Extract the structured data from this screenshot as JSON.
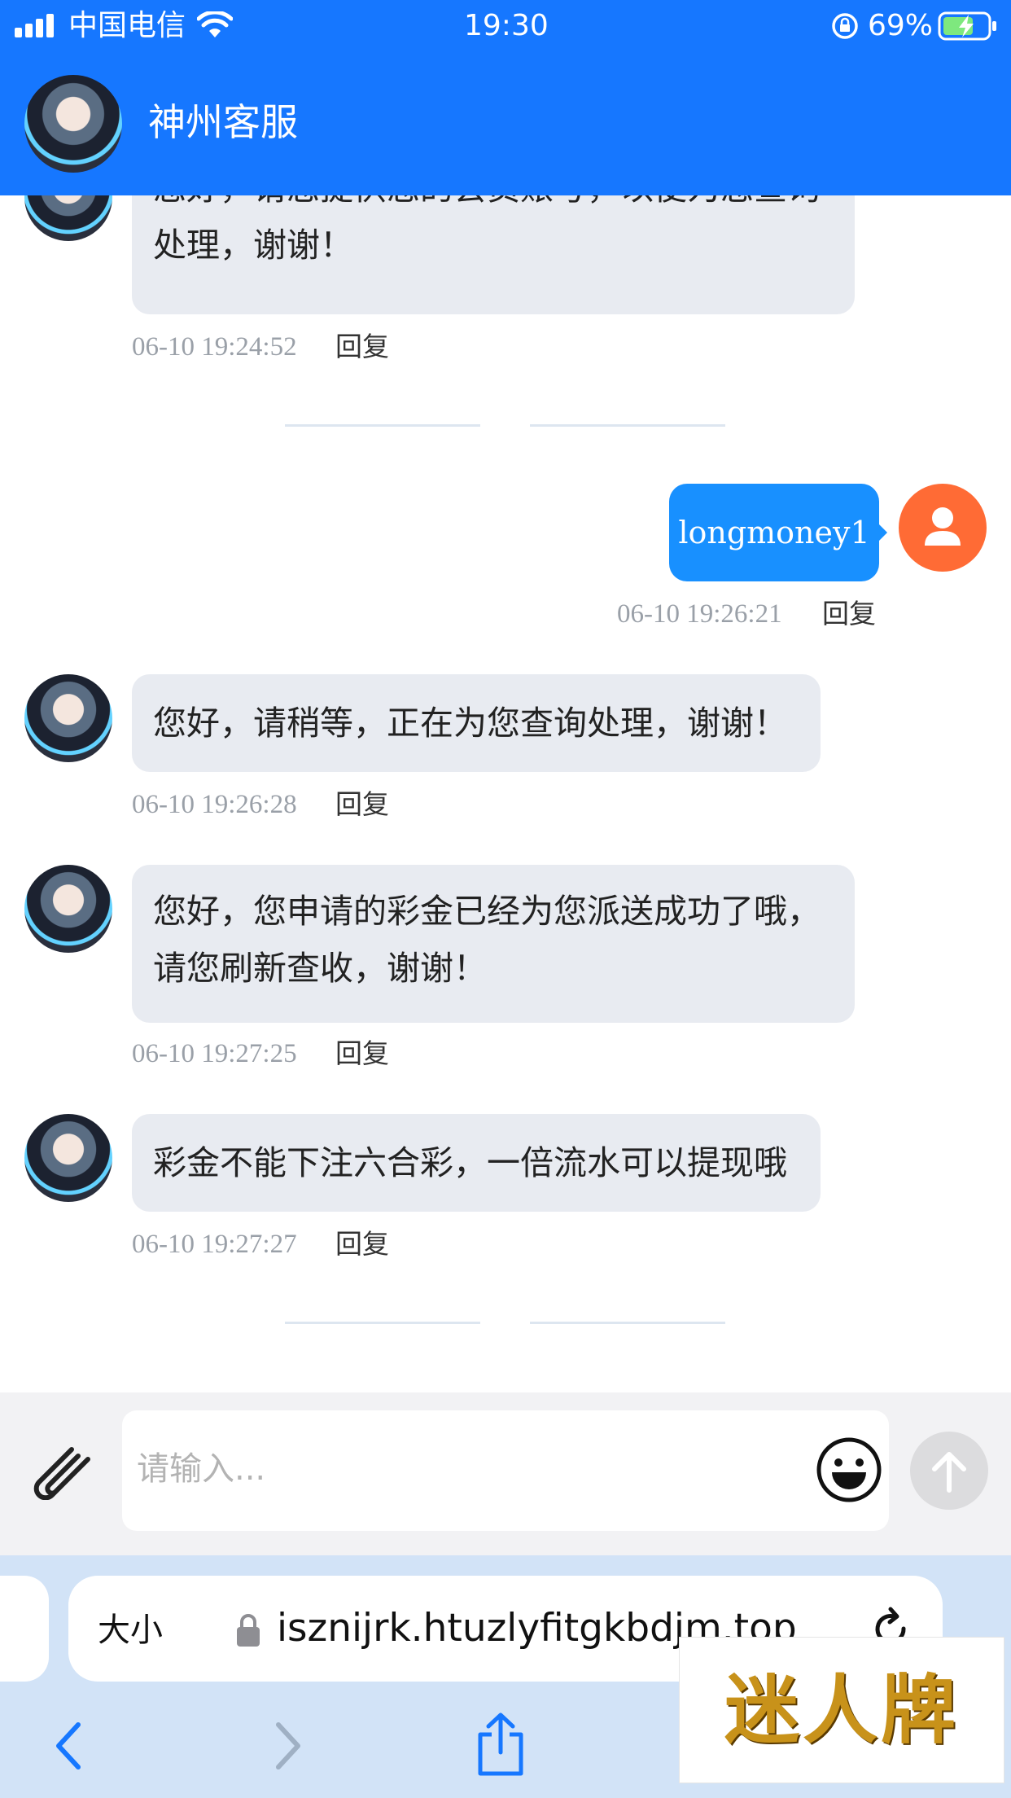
{
  "status_bar": {
    "carrier": "中国电信",
    "time": "19:30",
    "battery": "69%"
  },
  "header": {
    "title": "神州客服"
  },
  "messages": [
    {
      "sender": "agent",
      "text_lines": [
        "您好，请您提供您的会员账号，以便为您查询",
        "处理，谢谢！"
      ],
      "time": "06-10 19:24:52",
      "reply": "回复"
    },
    {
      "sender": "user",
      "text": "longmoney1",
      "time": "06-10 19:26:21",
      "reply": "回复"
    },
    {
      "sender": "agent",
      "text_lines": [
        "您好，请稍等，正在为您查询处理，谢谢！"
      ],
      "time": "06-10 19:26:28",
      "reply": "回复"
    },
    {
      "sender": "agent",
      "text_lines": [
        "您好，您申请的彩金已经为您派送成功了哦，",
        "请您刷新查收，谢谢！"
      ],
      "time": "06-10 19:27:25",
      "reply": "回复"
    },
    {
      "sender": "agent",
      "text_lines": [
        "彩金不能下注六合彩，一倍流水可以提现哦"
      ],
      "time": "06-10 19:27:27",
      "reply": "回复"
    }
  ],
  "composer": {
    "placeholder": "请输入..."
  },
  "browser": {
    "text_size_label": "大小",
    "url": "isznijrk.htuzlyfitgkbdjm.top"
  },
  "watermark": {
    "text": "迷人牌"
  },
  "colors": {
    "primary": "#1677ff",
    "user_bubble": "#1890ff",
    "agent_bubble": "#e8ebf1",
    "user_avatar": "#ff6b35"
  }
}
